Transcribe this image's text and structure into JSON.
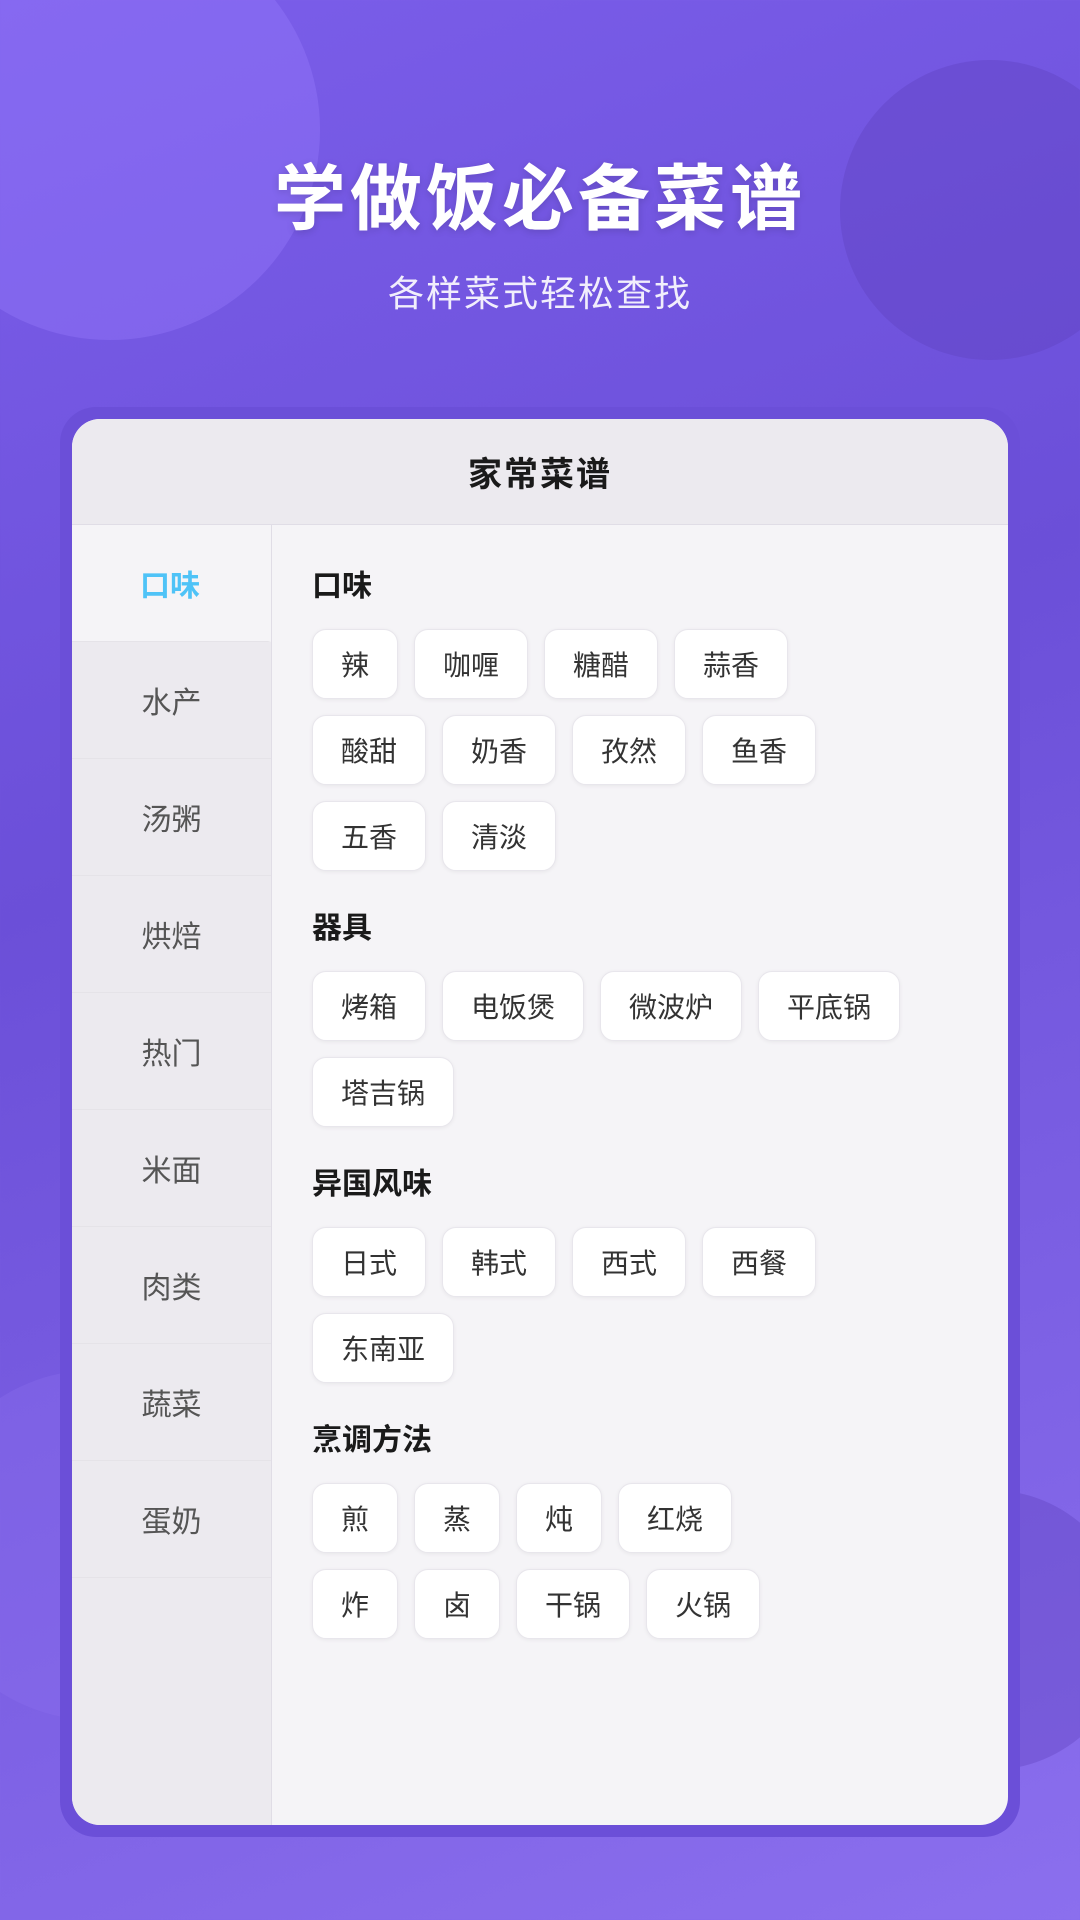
{
  "header": {
    "title": "学做饭必备菜谱",
    "subtitle": "各样菜式轻松查找"
  },
  "card": {
    "title": "家常菜谱"
  },
  "sidebar": {
    "items": [
      {
        "id": "kouwei",
        "label": "口味",
        "active": true
      },
      {
        "id": "shuichan",
        "label": "水产",
        "active": false
      },
      {
        "id": "tangzhou",
        "label": "汤粥",
        "active": false
      },
      {
        "id": "hongbei",
        "label": "烘焙",
        "active": false
      },
      {
        "id": "remen",
        "label": "热门",
        "active": false
      },
      {
        "id": "mimian",
        "label": "米面",
        "active": false
      },
      {
        "id": "roulei",
        "label": "肉类",
        "active": false
      },
      {
        "id": "shucai",
        "label": "蔬菜",
        "active": false
      },
      {
        "id": "dannai",
        "label": "蛋奶",
        "active": false
      }
    ]
  },
  "sections": [
    {
      "id": "kouwei",
      "title": "口味",
      "rows": [
        [
          "辣",
          "咖喱",
          "糖醋",
          "蒜香"
        ],
        [
          "酸甜",
          "奶香",
          "孜然",
          "鱼香"
        ],
        [
          "五香",
          "清淡"
        ]
      ]
    },
    {
      "id": "qiju",
      "title": "器具",
      "rows": [
        [
          "烤箱",
          "电饭煲",
          "微波炉",
          "平底锅"
        ],
        [
          "塔吉锅"
        ]
      ]
    },
    {
      "id": "yiguofengwei",
      "title": "异国风味",
      "rows": [
        [
          "日式",
          "韩式",
          "西式",
          "西餐"
        ],
        [
          "东南亚"
        ]
      ]
    },
    {
      "id": "pengtiaofahfa",
      "title": "烹调方法",
      "rows": [
        [
          "煎",
          "蒸",
          "炖",
          "红烧"
        ],
        [
          "炸",
          "卤",
          "干锅",
          "火锅"
        ]
      ]
    }
  ]
}
